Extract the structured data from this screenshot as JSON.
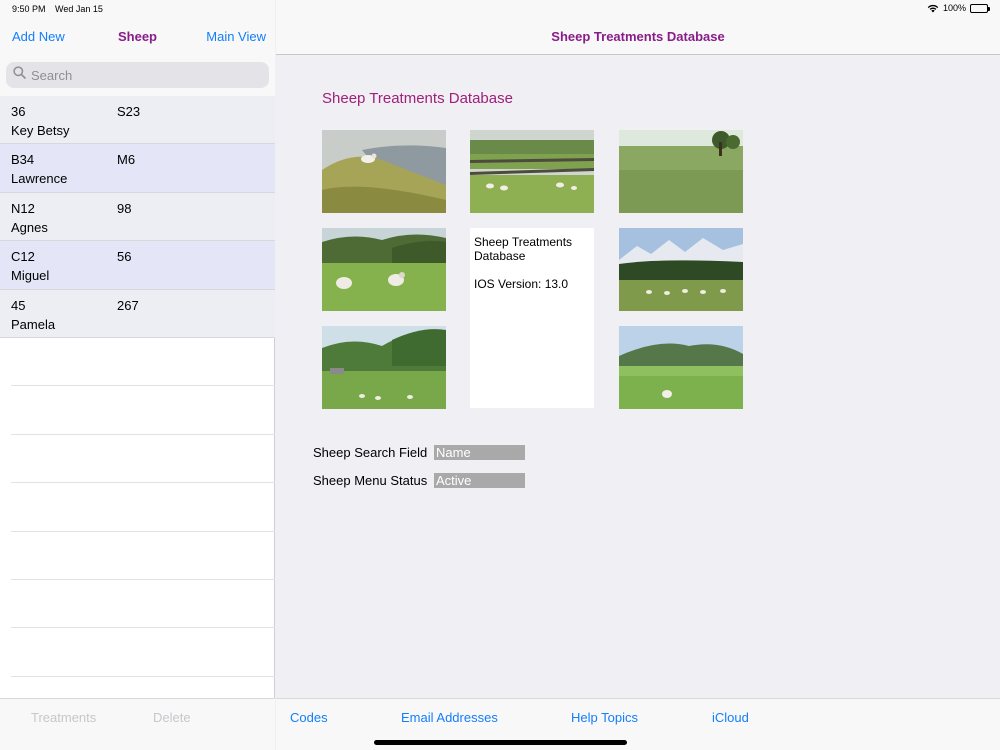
{
  "status_bar": {
    "time": "9:50 PM",
    "date": "Wed Jan 15",
    "battery": "100%"
  },
  "master": {
    "add_new": "Add New",
    "title": "Sheep",
    "main_view": "Main View",
    "search_placeholder": "Search",
    "rows": [
      {
        "c1": "36",
        "c2": "S23",
        "name": "Key Betsy"
      },
      {
        "c1": "B34",
        "c2": "M6",
        "name": "Lawrence"
      },
      {
        "c1": "N12",
        "c2": "98",
        "name": "Agnes"
      },
      {
        "c1": "C12",
        "c2": "56",
        "name": "Miguel"
      },
      {
        "c1": "45",
        "c2": "267",
        "name": "Pamela"
      }
    ],
    "toolbar": {
      "treatments": "Treatments",
      "delete": "Delete"
    }
  },
  "detail": {
    "nav_title": "Sheep Treatments Database",
    "content_title": "Sheep Treatments Database",
    "info": {
      "title": "Sheep Treatments Database",
      "version": "IOS Version:  13.0"
    },
    "fields": [
      {
        "label": "Sheep Search Field",
        "value": "Name"
      },
      {
        "label": "Sheep Menu Status",
        "value": "Active"
      }
    ],
    "toolbar": {
      "codes": "Codes",
      "email": "Email Addresses",
      "help": "Help Topics",
      "icloud": "iCloud"
    }
  },
  "colors": {
    "accent": "#147efb",
    "title_purple": "#8a1c8a",
    "content_title": "#a0207a",
    "row_a": "#eceef4",
    "row_b": "#e4e5f6"
  }
}
